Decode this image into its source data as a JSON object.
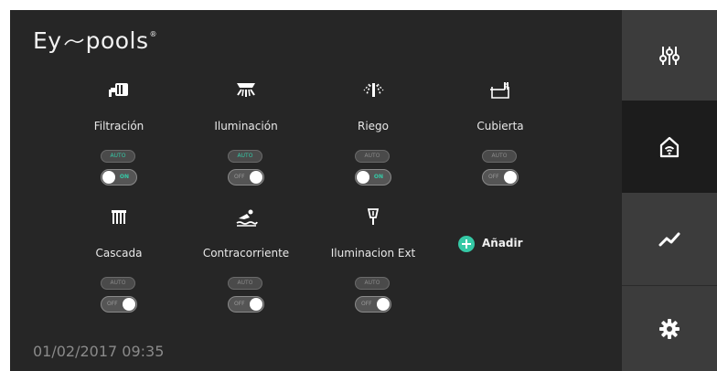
{
  "brand": {
    "logo_text_left": "Ey",
    "logo_text_right": "pools",
    "registered_mark": "®"
  },
  "datetime": "01/02/2017 09:35",
  "devices": [
    {
      "name": "Filtración",
      "icon": "pump-icon",
      "auto_label": "AUTO",
      "auto_active": true,
      "switch_label": "ON",
      "switch_on": true
    },
    {
      "name": "Iluminación",
      "icon": "light-icon",
      "auto_label": "AUTO",
      "auto_active": true,
      "switch_label": "OFF",
      "switch_on": false
    },
    {
      "name": "Riego",
      "icon": "irrigation-icon",
      "auto_label": "AUTO",
      "auto_active": false,
      "switch_label": "ON",
      "switch_on": true
    },
    {
      "name": "Cubierta",
      "icon": "pool-cover-icon",
      "auto_label": "AUTO",
      "auto_active": false,
      "switch_label": "OFF",
      "switch_on": false
    },
    {
      "name": "Cascada",
      "icon": "waterfall-icon",
      "auto_label": "AUTO",
      "auto_active": false,
      "switch_label": "OFF",
      "switch_on": false
    },
    {
      "name": "Contracorriente",
      "icon": "swimmer-icon",
      "auto_label": "AUTO",
      "auto_active": false,
      "switch_label": "OFF",
      "switch_on": false
    },
    {
      "name": "Iluminacion Ext",
      "icon": "garden-lamp-icon",
      "auto_label": "AUTO",
      "auto_active": false,
      "switch_label": "OFF",
      "switch_on": false
    }
  ],
  "add_button": {
    "label": "Añadir"
  },
  "sidebar": [
    {
      "icon": "sliders-icon",
      "active": false
    },
    {
      "icon": "home-wifi-icon",
      "active": true
    },
    {
      "icon": "trend-icon",
      "active": false
    },
    {
      "icon": "gear-icon",
      "active": false
    }
  ],
  "colors": {
    "accent": "#35c9a6",
    "background": "#262626",
    "sidebar": "#3c3c3c",
    "sidebar_active": "#1c1c1c"
  }
}
